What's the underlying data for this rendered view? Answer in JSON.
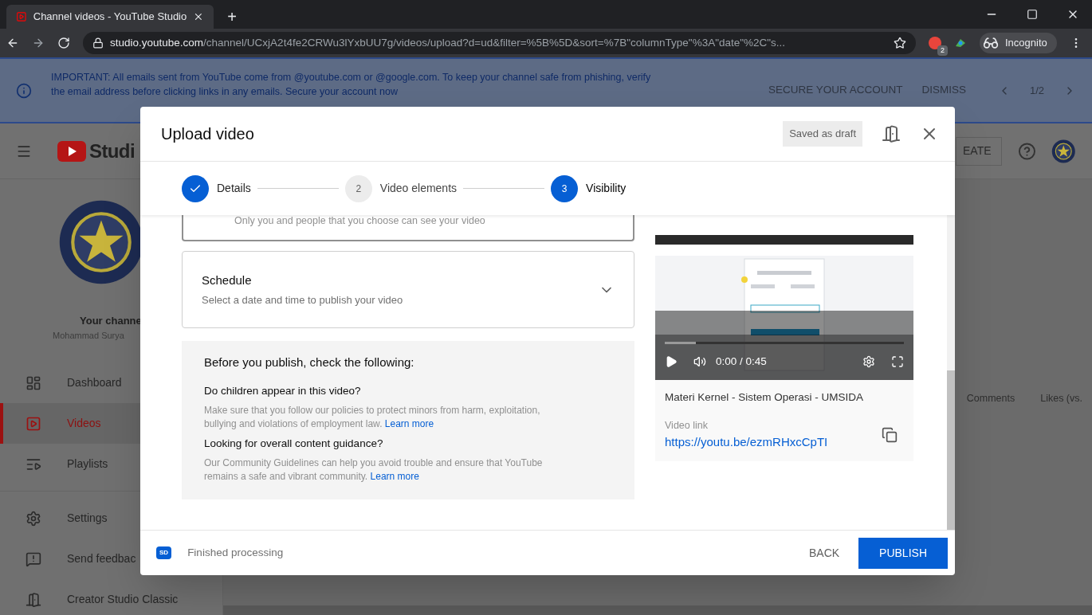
{
  "browser": {
    "tab_title": "Channel videos - YouTube Studio",
    "new_tab": "+",
    "host": "studio.youtube.com",
    "path": "/channel/UCxjA2t4fe2CRWu3lYxbUU7g/videos/upload?d=ud&filter=%5B%5D&sort=%7B\"columnType\"%3A\"date\"%2C\"s...",
    "extension_badge": "2",
    "incognito": "Incognito"
  },
  "banner": {
    "text": "IMPORTANT: All emails sent from YouTube come from @youtube.com or @google.com. To keep your channel safe from phishing, verify the email address before clicking links in any emails. Secure your account now",
    "actions": [
      "SECURE YOUR ACCOUNT",
      "DISMISS"
    ],
    "pager": "1/2"
  },
  "studio": {
    "logo": "Studi",
    "create": "EATE",
    "channel_name": "Your channe",
    "channel_owner": "Mohammad Surya",
    "nav": [
      {
        "kind": "dashboard",
        "label": "Dashboard",
        "selected": false
      },
      {
        "kind": "videos",
        "label": "Videos",
        "selected": true
      },
      {
        "kind": "playlists",
        "label": "Playlists",
        "selected": false
      },
      {
        "kind": "settings",
        "label": "Settings",
        "selected": false
      },
      {
        "kind": "feedback",
        "label": "Send feedbac",
        "selected": false
      },
      {
        "kind": "classic",
        "label": "Creator Studio Classic",
        "selected": false
      }
    ],
    "columns": [
      "Comments",
      "Likes (vs."
    ]
  },
  "dialog": {
    "title": "Upload video",
    "draft": "Saved as draft",
    "steps": [
      {
        "label": "Details",
        "done": true,
        "selected": false
      },
      {
        "label": "Video elements",
        "number": "2",
        "done": false,
        "selected": false
      },
      {
        "label": "Visibility",
        "number": "3",
        "done": false,
        "selected": true
      }
    ],
    "options": [
      {
        "kind": "partial",
        "description": "Only you and people that you choose can see your video"
      },
      {
        "kind": "expandable",
        "title": "Schedule",
        "description": "Select a date and time to publish your video",
        "expanded": false
      }
    ],
    "checklist": {
      "title": "Before you publish, check the following:",
      "items": [
        {
          "question": "Do children appear in this video?",
          "text": "Make sure that you follow our policies to protect minors from harm, exploitation, bullying and violations of employment law.",
          "link": "Learn more"
        },
        {
          "question": "Looking for overall content guidance?",
          "text": "Our Community Guidelines can help you avoid trouble and ensure that YouTube remains a safe and vibrant community.",
          "link": "Learn more"
        }
      ]
    },
    "preview": {
      "level": 0.13,
      "time": "0:00 / 0:45",
      "title": "Materi Kernel - Sistem Operasi - UMSIDA",
      "link_label": "Video link",
      "url": "https://youtu.be/ezmRHxcCpTI"
    },
    "footer": {
      "badge": "SD",
      "status": "Finished processing",
      "back": "BACK",
      "publish": "PUBLISH"
    }
  }
}
